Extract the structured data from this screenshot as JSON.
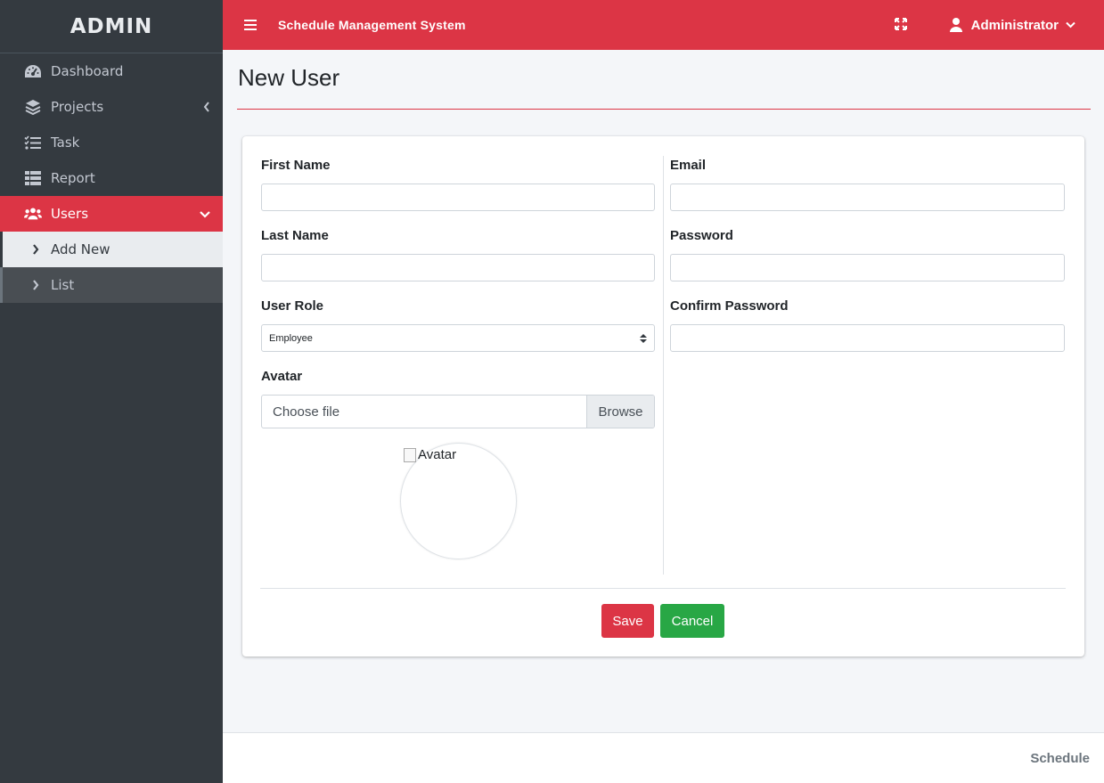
{
  "sidebar": {
    "brand": "ADMIN",
    "items": [
      {
        "label": "Dashboard",
        "icon": "dashboard-icon"
      },
      {
        "label": "Projects",
        "icon": "layers-icon"
      },
      {
        "label": "Task",
        "icon": "tasks-icon"
      },
      {
        "label": "Report",
        "icon": "list-icon"
      },
      {
        "label": "Users",
        "icon": "users-icon"
      }
    ],
    "users_submenu": [
      {
        "label": "Add New",
        "icon": "chevron-right-icon"
      },
      {
        "label": "List",
        "icon": "chevron-right-icon"
      }
    ]
  },
  "topbar": {
    "title": "Schedule Management System",
    "user_name": "Administrator"
  },
  "page": {
    "title": "New User"
  },
  "form": {
    "first_name": {
      "label": "First Name",
      "value": ""
    },
    "last_name": {
      "label": "Last Name",
      "value": ""
    },
    "user_role": {
      "label": "User Role",
      "selected": "Employee"
    },
    "avatar": {
      "label": "Avatar",
      "file_placeholder": "Choose file",
      "browse_label": "Browse",
      "preview_alt": "Avatar"
    },
    "email": {
      "label": "Email",
      "value": ""
    },
    "password": {
      "label": "Password",
      "value": ""
    },
    "confirm_password": {
      "label": "Confirm Password",
      "value": ""
    },
    "save_label": "Save",
    "cancel_label": "Cancel"
  },
  "footer": {
    "text": "Schedule"
  },
  "colors": {
    "accent": "#dc3545",
    "sidebar_bg": "#343a40",
    "success": "#28a745"
  }
}
